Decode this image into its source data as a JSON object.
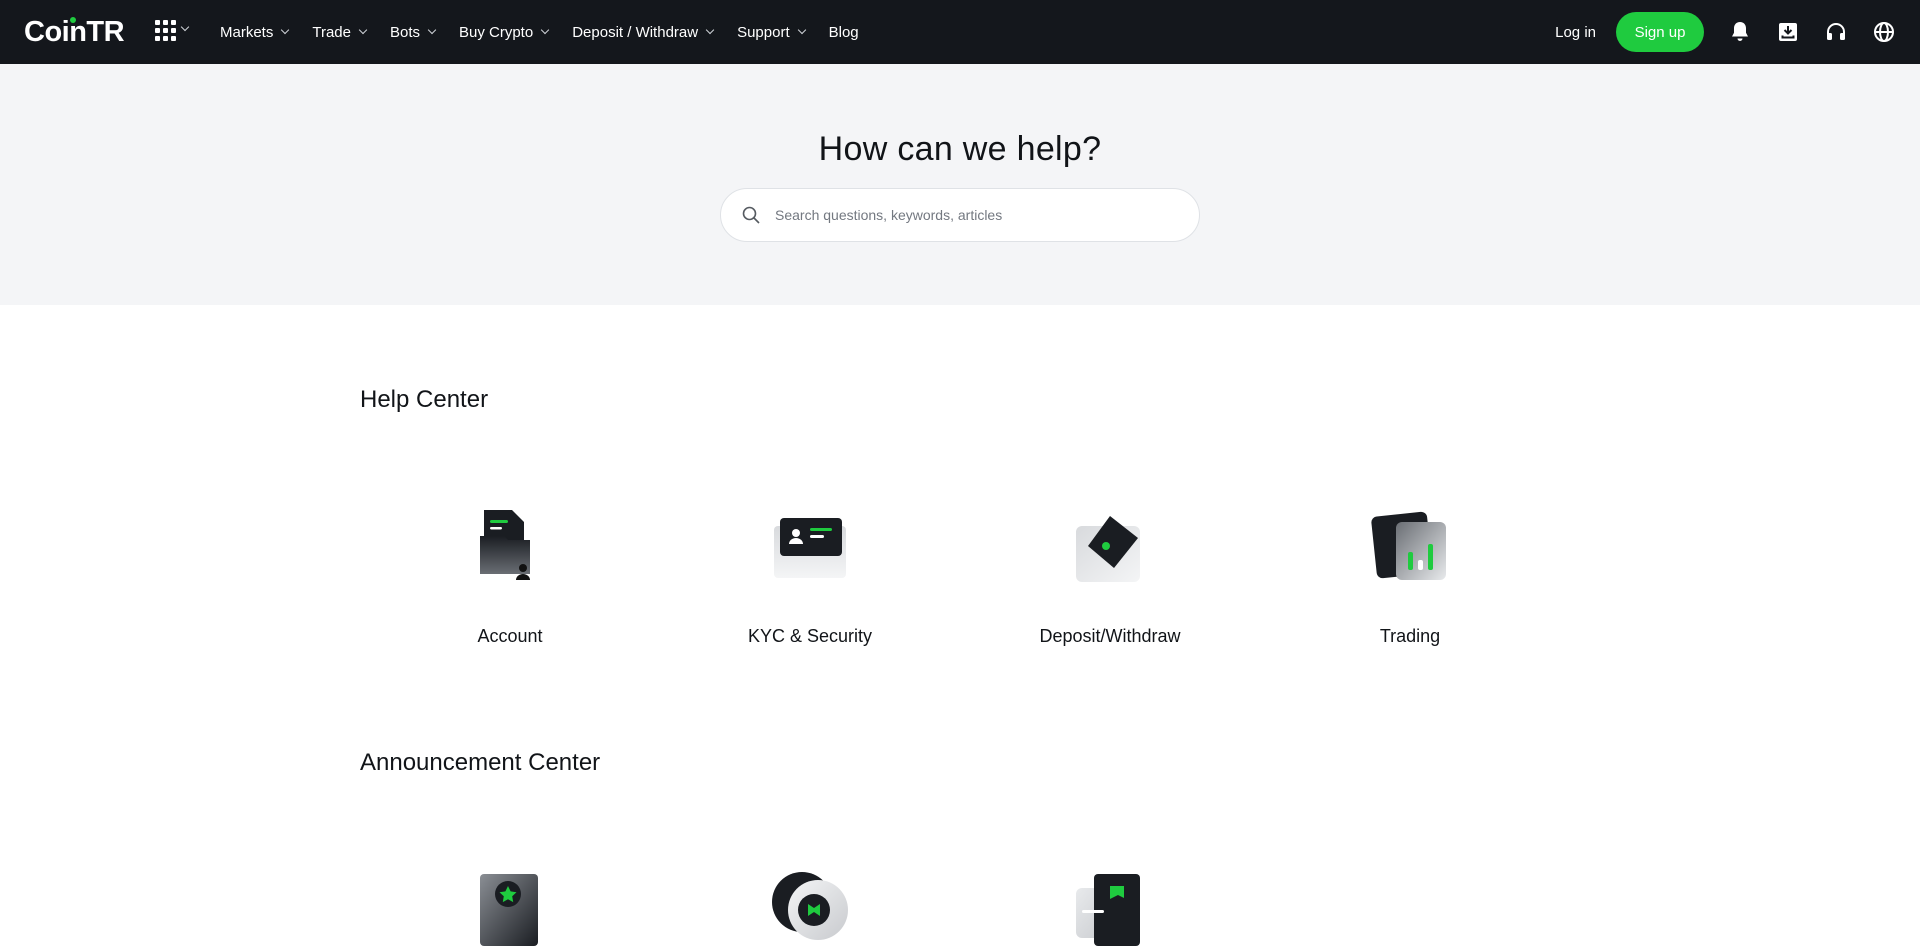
{
  "nav": {
    "logo": "CoinTR",
    "menu": [
      {
        "label": "Markets",
        "dropdown": true
      },
      {
        "label": "Trade",
        "dropdown": true
      },
      {
        "label": "Bots",
        "dropdown": true
      },
      {
        "label": "Buy Crypto",
        "dropdown": true
      },
      {
        "label": "Deposit / Withdraw",
        "dropdown": true
      },
      {
        "label": "Support",
        "dropdown": true
      },
      {
        "label": "Blog",
        "dropdown": false
      }
    ],
    "login": "Log in",
    "signup": "Sign up",
    "icons": [
      "bell-icon",
      "download-icon",
      "headset-icon",
      "globe-icon"
    ]
  },
  "hero": {
    "title": "How can we help?",
    "search_placeholder": "Search questions, keywords, articles"
  },
  "help_center": {
    "title": "Help Center",
    "cards": [
      {
        "label": "Account",
        "icon": "account-folder-icon"
      },
      {
        "label": "KYC & Security",
        "icon": "id-card-icon"
      },
      {
        "label": "Deposit/Withdraw",
        "icon": "wallet-icon"
      },
      {
        "label": "Trading",
        "icon": "trading-chart-icon"
      }
    ]
  },
  "announcement_center": {
    "title": "Announcement Center",
    "cards": [
      {
        "icon": "star-document-icon"
      },
      {
        "icon": "coin-icon"
      },
      {
        "icon": "flag-document-icon"
      }
    ]
  },
  "colors": {
    "nav_bg": "#14171c",
    "accent": "#1fcb3f",
    "hero_bg": "#f4f5f7"
  }
}
